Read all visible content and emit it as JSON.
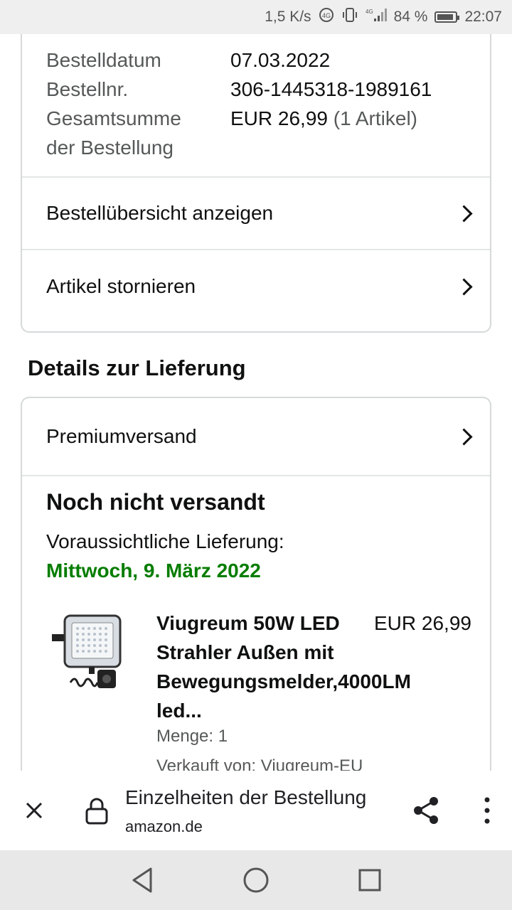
{
  "status_bar": {
    "speed": "1,5 K/s",
    "network": "4G",
    "battery": "84 %",
    "time": "22:07"
  },
  "order_info": {
    "rows": [
      {
        "label": "Bestelldatum",
        "value": "07.03.2022"
      },
      {
        "label": "Bestellnr.",
        "value": "306-1445318-1989161"
      }
    ],
    "total_label_line1": "Gesamtsumme",
    "total_label_line2": "der Bestellung",
    "total_value": "EUR 26,99",
    "total_items": "(1 Artikel)"
  },
  "actions": {
    "view_summary": "Bestellübersicht anzeigen",
    "cancel_items": "Artikel stornieren"
  },
  "delivery": {
    "section_title": "Details zur Lieferung",
    "shipping_method": "Premiumversand",
    "status": "Noch nicht versandt",
    "expected_label": "Voraussichtliche Lieferung:",
    "expected_date": "Mittwoch, 9. März 2022",
    "date_color": "#067d00"
  },
  "product": {
    "title_lines": [
      "Viugreum 50W LED",
      "Strahler Außen mit",
      "Bewegungsmelder,4000LM",
      "led..."
    ],
    "price": "EUR 26,99",
    "quantity": "Menge: 1",
    "seller": "Verkauft von: Viugreum-EU"
  },
  "browser_bar": {
    "page_title": "Einzelheiten der Bestellung",
    "domain": "amazon.de"
  },
  "icons": [
    "close-icon",
    "lock-icon",
    "share-icon",
    "more-vert-icon",
    "back-icon",
    "home-icon",
    "recents-icon",
    "chevron-right-icon"
  ]
}
